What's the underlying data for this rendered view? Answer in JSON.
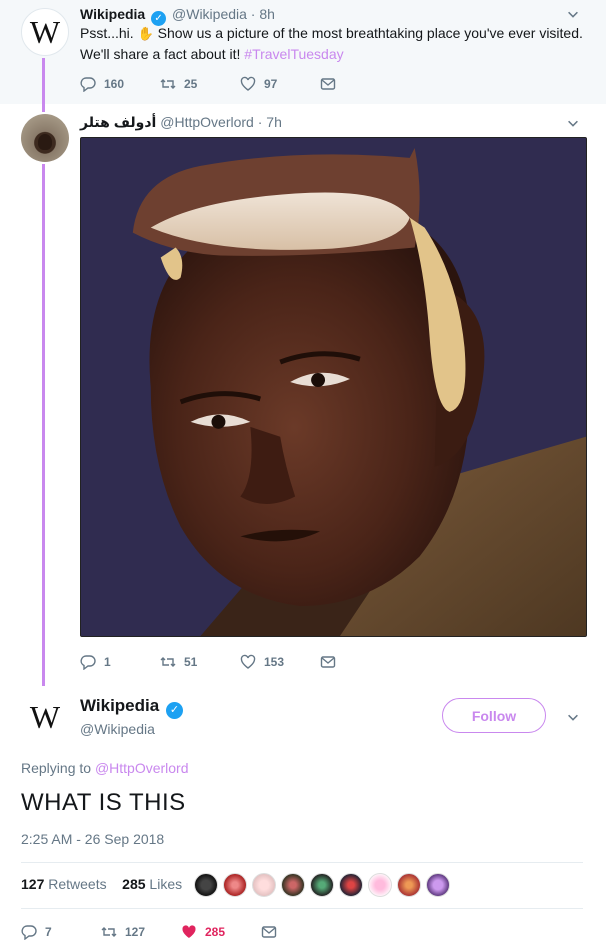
{
  "tweet1": {
    "name": "Wikipedia",
    "handle": "@Wikipedia",
    "time": "8h",
    "avatar_glyph": "W",
    "text_before": "Psst...hi. ",
    "emoji": "wave-hand-icon",
    "text_after": " Show us a picture of the most breathtaking place you've ever visited. We'll share a fact about it! ",
    "hashtag": "#TravelTuesday",
    "replies": "160",
    "retweets": "25",
    "likes": "97"
  },
  "tweet2": {
    "name": "أدولف هتلر",
    "handle": "@HttpOverlord",
    "time": "7h",
    "replies": "1",
    "retweets": "51",
    "likes": "153"
  },
  "focused": {
    "name": "Wikipedia",
    "handle": "@Wikipedia",
    "avatar_glyph": "W",
    "follow_label": "Follow",
    "replying_prefix": "Replying to ",
    "replying_to": "@HttpOverlord",
    "text": "WHAT IS THIS",
    "timestamp": "2:25 AM - 26 Sep 2018",
    "retweet_count": "127",
    "retweets_label": "Retweets",
    "like_count": "285",
    "likes_label": "Likes",
    "replies": "7",
    "retweets": "127",
    "likes": "285"
  },
  "colors": {
    "accent": "#c988ee",
    "verified": "#1da1f2",
    "like_active": "#e0245e",
    "muted": "#657786"
  },
  "separator": " · "
}
